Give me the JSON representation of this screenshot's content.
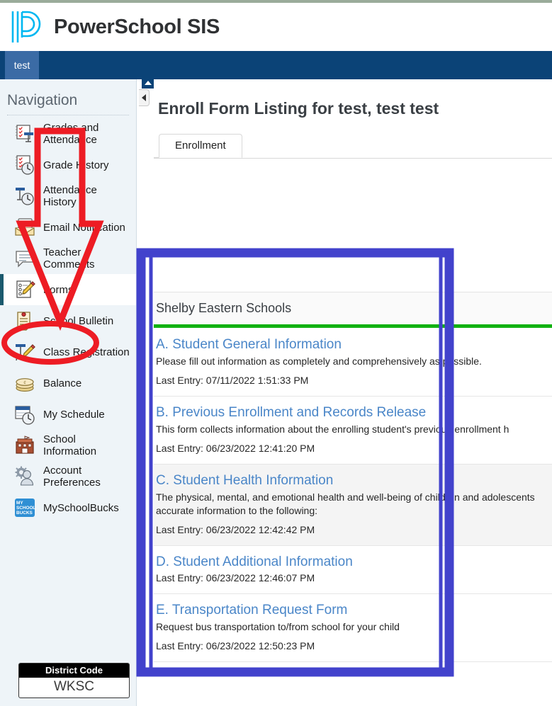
{
  "brand": {
    "title": "PowerSchool SIS",
    "logo_icon": "powerschool-p-logo"
  },
  "student_tab": {
    "label": "test"
  },
  "sidebar": {
    "title": "Navigation",
    "items": [
      {
        "label": "Grades and Attendance",
        "icon": "grades-attendance-icon",
        "selected": false
      },
      {
        "label": "Grade History",
        "icon": "grade-history-icon",
        "selected": false
      },
      {
        "label": "Attendance History",
        "icon": "attendance-history-icon",
        "selected": false
      },
      {
        "label": "Email Notification",
        "icon": "email-notification-icon",
        "selected": false
      },
      {
        "label": "Teacher Comments",
        "icon": "teacher-comments-icon",
        "selected": false
      },
      {
        "label": "Forms",
        "icon": "forms-icon",
        "selected": true
      },
      {
        "label": "School Bulletin",
        "icon": "school-bulletin-icon",
        "selected": false
      },
      {
        "label": "Class Registration",
        "icon": "class-registration-icon",
        "selected": false
      },
      {
        "label": "Balance",
        "icon": "balance-icon",
        "selected": false
      },
      {
        "label": "My Schedule",
        "icon": "my-schedule-icon",
        "selected": false
      },
      {
        "label": "School Information",
        "icon": "school-information-icon",
        "selected": false
      },
      {
        "label": "Account Preferences",
        "icon": "account-preferences-icon",
        "selected": false
      },
      {
        "label": "MySchoolBucks",
        "icon": "myschoolbucks-icon",
        "selected": false
      }
    ],
    "district_code": {
      "label": "District Code",
      "value": "WKSC"
    }
  },
  "main": {
    "page_title": "Enroll Form Listing for test, test test",
    "tabs": [
      {
        "label": "Enrollment",
        "active": true
      }
    ],
    "school_name": "Shelby Eastern Schools",
    "forms": [
      {
        "title": "A. Student General Information",
        "description": "Please fill out information as completely and comprehensively as possible.",
        "last_entry": "Last Entry: 07/11/2022 1:51:33 PM",
        "alt_row": false
      },
      {
        "title": "B. Previous Enrollment and Records Release",
        "description": "This form collects information about the enrolling student's previous enrollment h",
        "last_entry": "Last Entry: 06/23/2022 12:41:20 PM",
        "alt_row": false
      },
      {
        "title": "C. Student Health Information",
        "description": "The physical, mental, and emotional health and well-being of children and adolescents accurate information to the following:",
        "last_entry": "Last Entry: 06/23/2022 12:42:42 PM",
        "alt_row": true
      },
      {
        "title": "D. Student Additional Information",
        "description": "",
        "last_entry": "Last Entry: 06/23/2022 12:46:07 PM",
        "alt_row": false
      },
      {
        "title": "E. Transportation Request Form",
        "description": "Request bus transportation to/from school for your child",
        "last_entry": "Last Entry: 06/23/2022 12:50:23 PM",
        "alt_row": false
      }
    ]
  },
  "controls": {
    "collapse_up_icon": "caret-up-icon",
    "collapse_left_icon": "caret-left-icon"
  },
  "annotations": {
    "arrow": {
      "shape": "down-arrow-outline",
      "color": "#ed1c24",
      "points_to": "Forms"
    },
    "ellipse": {
      "shape": "ellipse-outline",
      "color": "#ed1c24",
      "encircles": "Forms"
    },
    "rectangle_outer": {
      "shape": "rectangle-outline",
      "color": "#4242cc",
      "encloses": "forms-list"
    },
    "rectangle_inner": {
      "shape": "rectangle-outline",
      "color": "#4242cc",
      "encloses": "forms-list"
    }
  },
  "colors": {
    "brand_navy": "#0b4377",
    "student_tab_blue": "#3b6ba5",
    "logo_cyan": "#00b7f1",
    "link_blue": "#4a86c8",
    "green_rule": "#12b212",
    "sidebar_bg": "#eef4f8",
    "selected_border": "#1b5a6e",
    "annotation_red": "#ed1c24",
    "annotation_blue": "#4242cc"
  }
}
